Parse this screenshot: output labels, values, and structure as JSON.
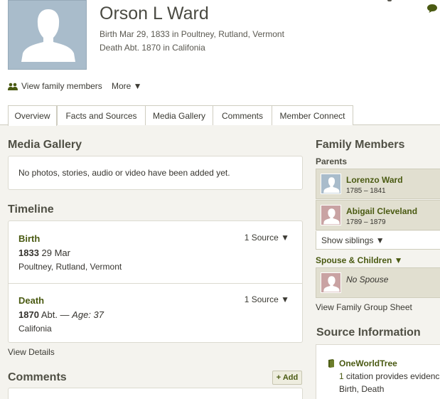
{
  "person": {
    "name": "Orson L Ward",
    "birth": "Birth Mar 29, 1833 in Poultney, Rutland, Vermont",
    "death": "Death Abt. 1870 in Califonia"
  },
  "actions": {
    "view_family": "View family members",
    "more": "More ▼"
  },
  "tabs": [
    {
      "label": "Overview"
    },
    {
      "label": "Facts and Sources"
    },
    {
      "label": "Media Gallery"
    },
    {
      "label": "Comments"
    },
    {
      "label": "Member Connect"
    }
  ],
  "media": {
    "heading": "Media Gallery",
    "empty_text": "No photos, stories, audio or video have been added yet."
  },
  "timeline": {
    "heading": "Timeline",
    "events": [
      {
        "title": "Birth",
        "year": "1833",
        "date_rest": " 29 Mar",
        "age": "",
        "place": "Poultney, Rutland, Vermont",
        "source": "1 Source ▼"
      },
      {
        "title": "Death",
        "year": "1870",
        "date_rest": " Abt. — ",
        "age": "Age: 37",
        "place": "Califonia",
        "source": "1 Source ▼"
      }
    ],
    "view_details": "View Details"
  },
  "comments": {
    "heading": "Comments",
    "add_label": "+ Add"
  },
  "family": {
    "heading": "Family Members",
    "parents_label": "Parents",
    "parents": [
      {
        "name": "Lorenzo Ward",
        "years": "1785 – 1841"
      },
      {
        "name": "Abigail Cleveland",
        "years": "1789 – 1879"
      }
    ],
    "show_siblings": "Show siblings ▼",
    "spouse_label": "Spouse & Children ▼",
    "no_spouse": "No Spouse",
    "group_sheet": "View Family Group Sheet"
  },
  "sources": {
    "heading": "Source Information",
    "source_name": "OneWorldTree",
    "citation_count": "1",
    "citation_text": " citation provides evidenc",
    "facts": "Birth, Death"
  },
  "colors": {
    "accent_green": "#4a5a12",
    "panel_bg": "#f4f3ee",
    "person_row_bg": "#e1dfd0",
    "male_avatar": "#a9bccb",
    "female_avatar": "#c9a3a3"
  }
}
